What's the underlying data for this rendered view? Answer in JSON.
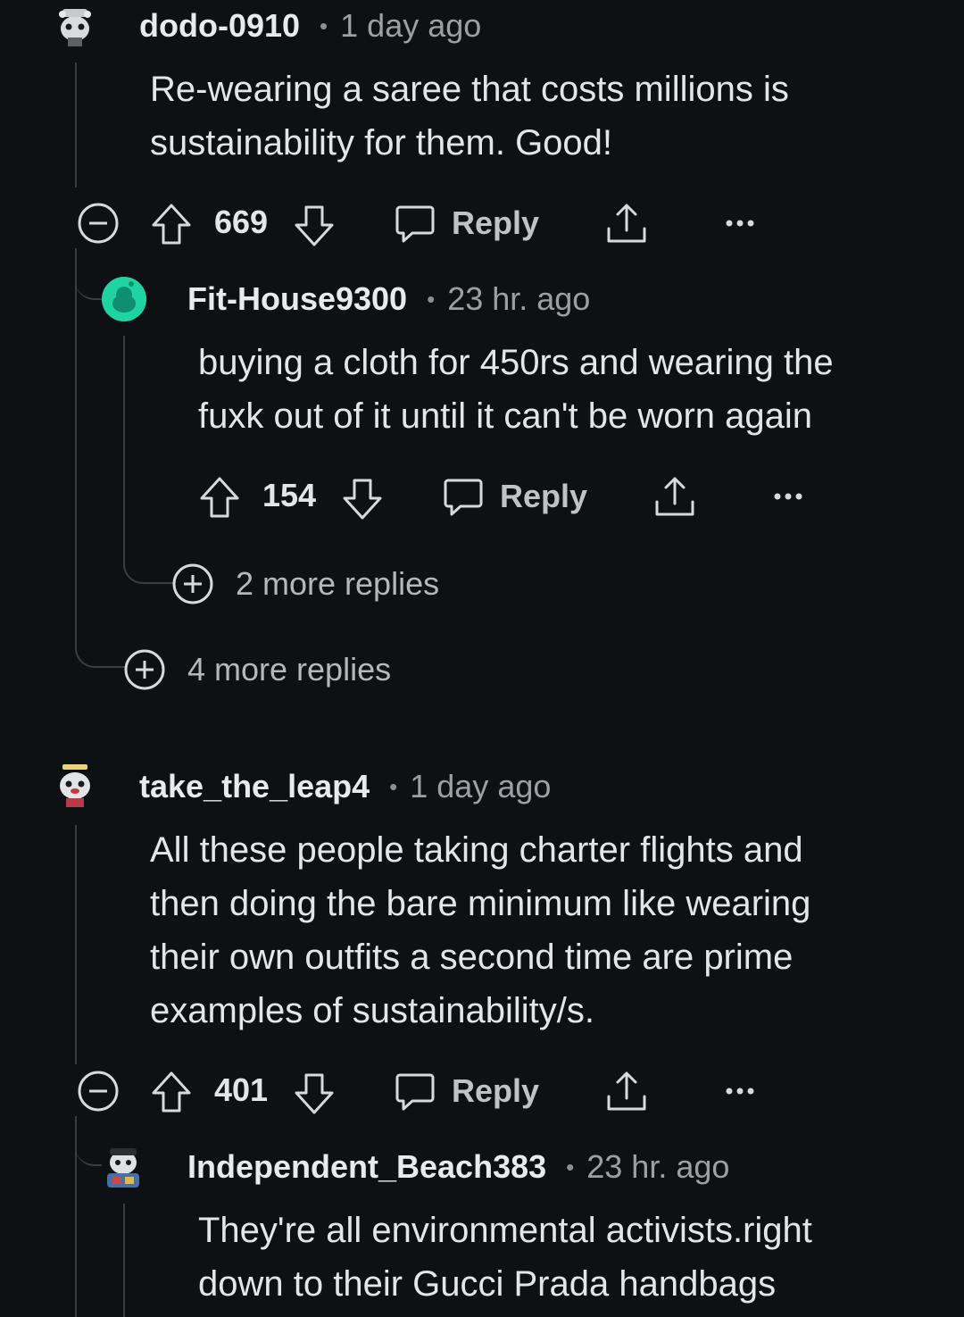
{
  "comments": [
    {
      "username": "dodo-0910",
      "time": "1 day ago",
      "body": [
        "Re-wearing a saree that costs millions is",
        "sustainability for them. Good!"
      ],
      "votes": "669",
      "reply_label": "Reply",
      "replies": [
        {
          "username": "Fit-House9300",
          "time": "23 hr. ago",
          "body": [
            "buying a cloth for 450rs and wearing the",
            "fuxk out of it until it can't be worn again"
          ],
          "votes": "154",
          "reply_label": "Reply",
          "more_replies": "2 more replies"
        }
      ],
      "more_replies": "4 more replies"
    },
    {
      "username": "take_the_leap4",
      "time": "1 day ago",
      "body": [
        "All these people taking charter flights and",
        "then doing the bare minimum like wearing",
        "their own outfits a second time are prime",
        "examples of sustainability/s."
      ],
      "votes": "401",
      "reply_label": "Reply",
      "replies": [
        {
          "username": "Independent_Beach383",
          "time": "23 hr. ago",
          "body": [
            "They're all environmental activists.right",
            "down to their Gucci Prada handbags"
          ]
        }
      ]
    }
  ],
  "colors": {
    "background": "#0e1113",
    "thread_line": "#3a3d40",
    "avatar_teal": "#20d3a3"
  },
  "icons": [
    "snoo-avatar",
    "collapse-icon",
    "upvote-icon",
    "downvote-icon",
    "comment-icon",
    "share-icon",
    "more-icon",
    "expand-icon"
  ]
}
